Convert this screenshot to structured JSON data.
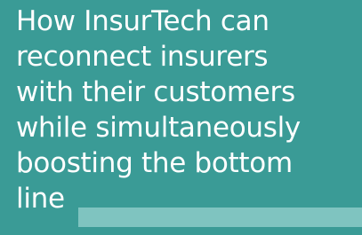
{
  "headline": {
    "line1": "How InsurTech can",
    "line2": "reconnect insurers",
    "line3": "with their customers",
    "line4": "while simultaneously",
    "line5": "boosting the bottom",
    "line6": "line"
  },
  "colors": {
    "background": "#3a9b96",
    "text": "#ffffff",
    "accent_bar": "#7fc4c0"
  }
}
